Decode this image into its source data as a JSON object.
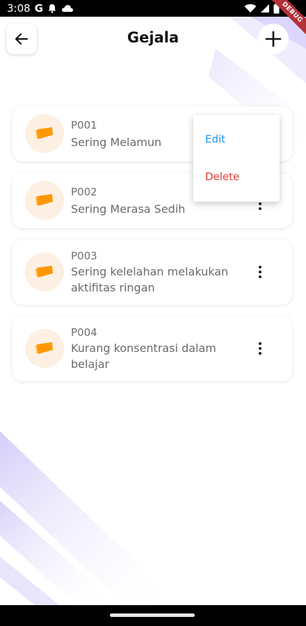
{
  "status_bar": {
    "time": "3:08",
    "icons": [
      "google-icon",
      "notification-bell-icon",
      "cloud-icon",
      "wifi-icon",
      "signal-icon",
      "battery-icon"
    ]
  },
  "debug_banner": "DEBUG",
  "app_bar": {
    "title": "Gejala",
    "back_icon": "arrow-left-icon",
    "add_icon": "plus-icon"
  },
  "items": [
    {
      "code": "P001",
      "name": "Sering Melamun"
    },
    {
      "code": "P002",
      "name": "Sering Merasa Sedih"
    },
    {
      "code": "P003",
      "name": "Sering kelelahan melakukan aktifitas ringan"
    },
    {
      "code": "P004",
      "name": "Kurang konsentrasi dalam belajar"
    }
  ],
  "popup_menu": {
    "edit_label": "Edit",
    "delete_label": "Delete"
  },
  "colors": {
    "accent_blue": "#2196F3",
    "danger_red": "#E53935",
    "icon_orange": "#FF9800",
    "avatar_bg": "#FDF0E3",
    "deco_purple": "#D9D4FB"
  }
}
